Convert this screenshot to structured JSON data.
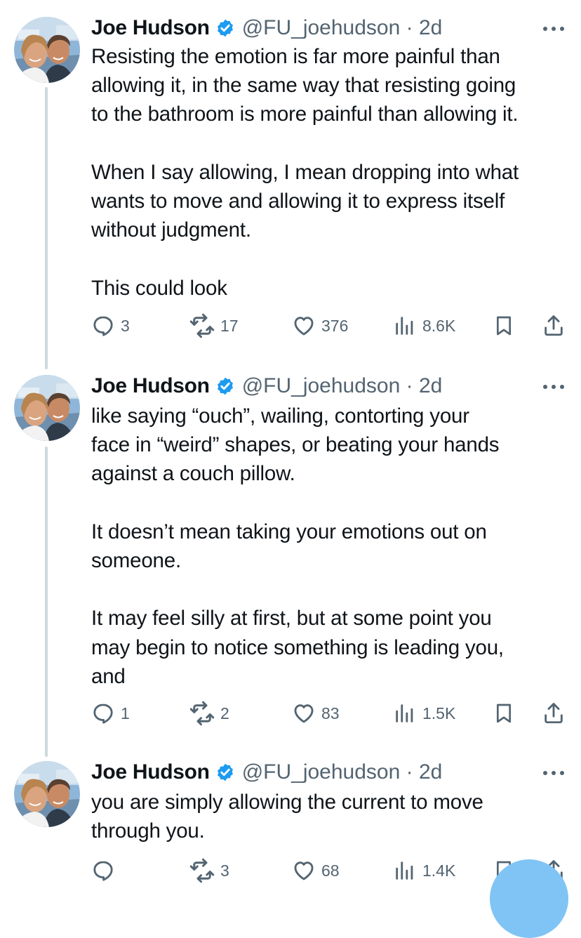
{
  "author": {
    "name": "Joe Hudson",
    "handle": "@FU_joehudson",
    "separator": "·",
    "verified_color": "#1d9bf0"
  },
  "tweets": [
    {
      "time": "2d",
      "text": "Resisting the emotion is far more painful than\nallowing it, in the same way that resisting going\nto the bathroom is more painful than allowing it.\n\nWhen I say allowing, I mean dropping into what\nwants to move and allowing it to express itself\nwithout judgment.\n\nThis could look",
      "replies": "3",
      "retweets": "17",
      "likes": "376",
      "views": "8.6K"
    },
    {
      "time": "2d",
      "text": "like saying “ouch”, wailing, contorting your\nface in “weird” shapes, or beating your hands\nagainst a couch pillow.\n\nIt doesn’t mean taking your emotions out on\nsomeone.\n\nIt may feel silly at first, but at some point you\nmay begin to notice something is leading you,\nand",
      "replies": "1",
      "retweets": "2",
      "likes": "83",
      "views": "1.5K"
    },
    {
      "time": "2d",
      "text": "you are simply allowing the current to move\nthrough you.",
      "replies": "",
      "retweets": "3",
      "likes": "68",
      "views": "1.4K"
    }
  ],
  "icons": {
    "reply": "reply-bubble-icon",
    "retweet": "retweet-icon",
    "like": "heart-icon",
    "views": "views-bar-chart-icon",
    "bookmark": "bookmark-icon",
    "share": "share-icon",
    "more": "more-dots-icon"
  }
}
